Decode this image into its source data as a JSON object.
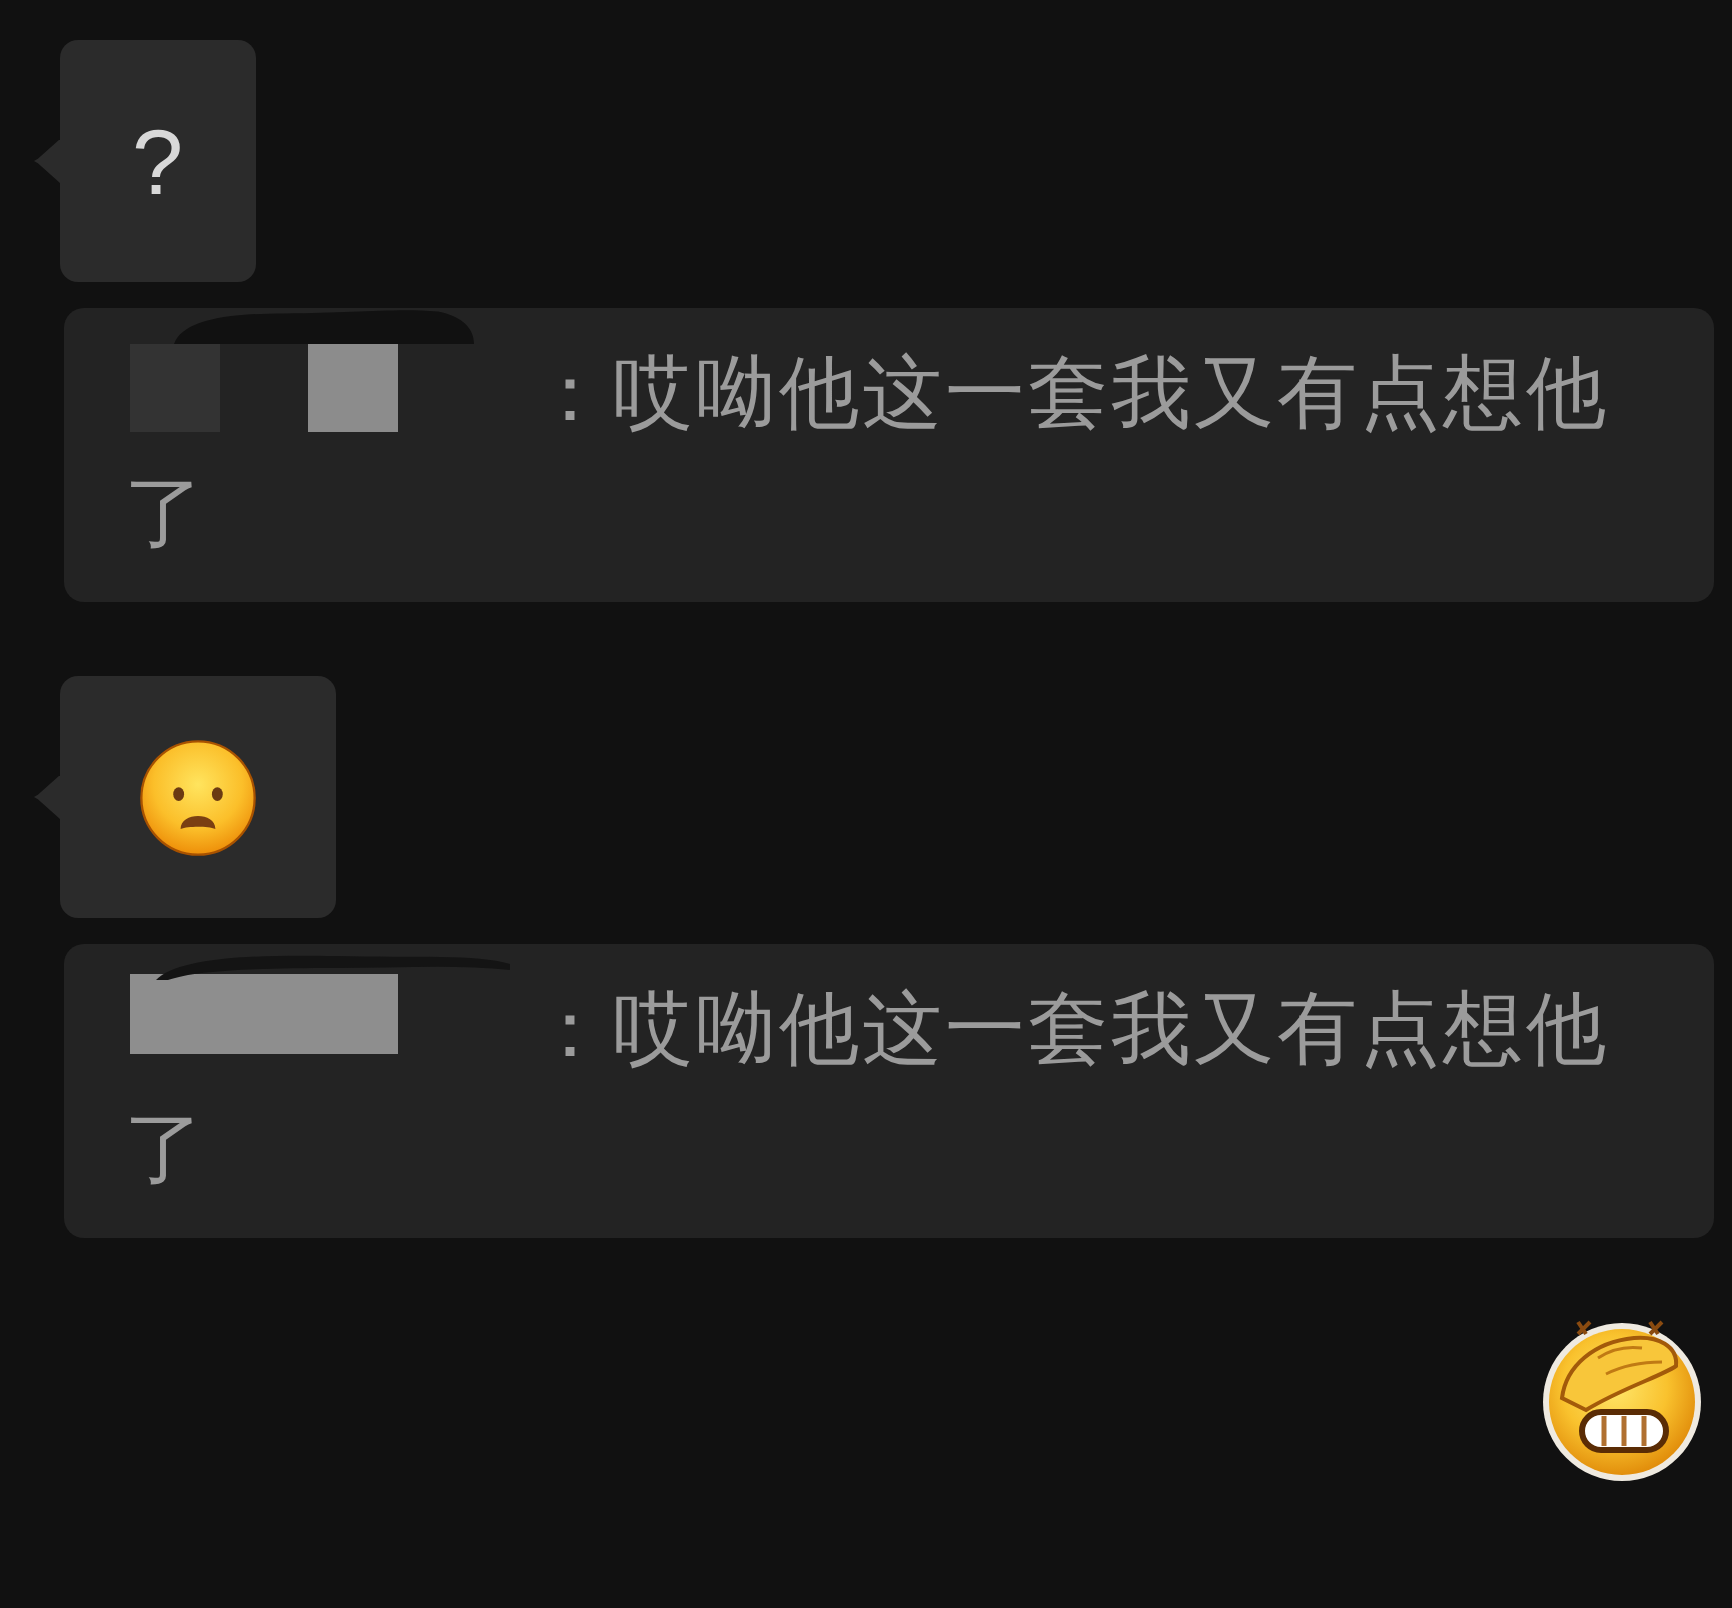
{
  "messages": [
    {
      "kind": "text",
      "text": "?",
      "quote": {
        "redaction": {
          "kind": "squares"
        },
        "lines": [
          "：哎呦他这一套我又有点想他",
          "了"
        ]
      }
    },
    {
      "kind": "emoji",
      "quote": {
        "redaction": {
          "kind": "bar"
        },
        "lines": [
          "：哎呦他这一套我又有点想他",
          "了"
        ]
      }
    },
    {
      "kind": "sticker"
    }
  ]
}
